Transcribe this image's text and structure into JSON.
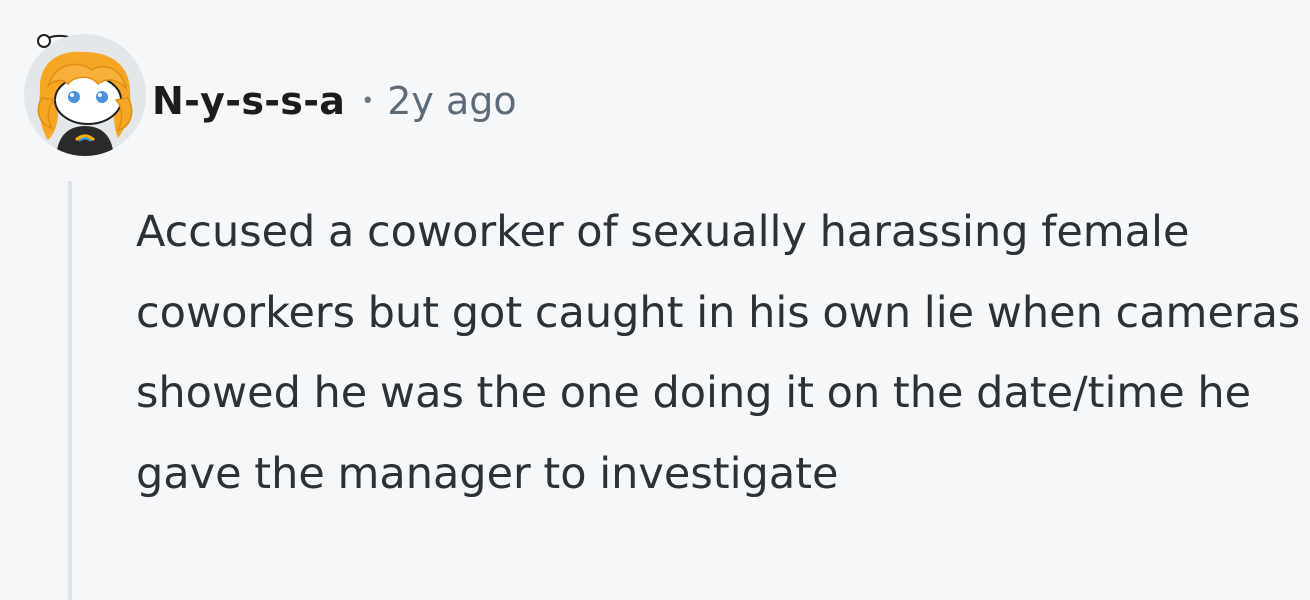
{
  "comment": {
    "author": "N-y-s-s-a",
    "separator": "•",
    "age": "2y ago",
    "body": "Accused a coworker of sexually harassing female coworkers but got caught in his own lie when cameras showed he was the one doing it on the date/time he gave the manager to investigate"
  },
  "icons": {
    "avatar": "snoo-avatar-orange-hair"
  },
  "colors": {
    "background": "#f6f7f8",
    "username": "#1a1c1e",
    "meta": "#5d6b78",
    "body": "#2b3137",
    "thread_line": "#dfe3e7",
    "avatar_hair": "#f5a623"
  }
}
